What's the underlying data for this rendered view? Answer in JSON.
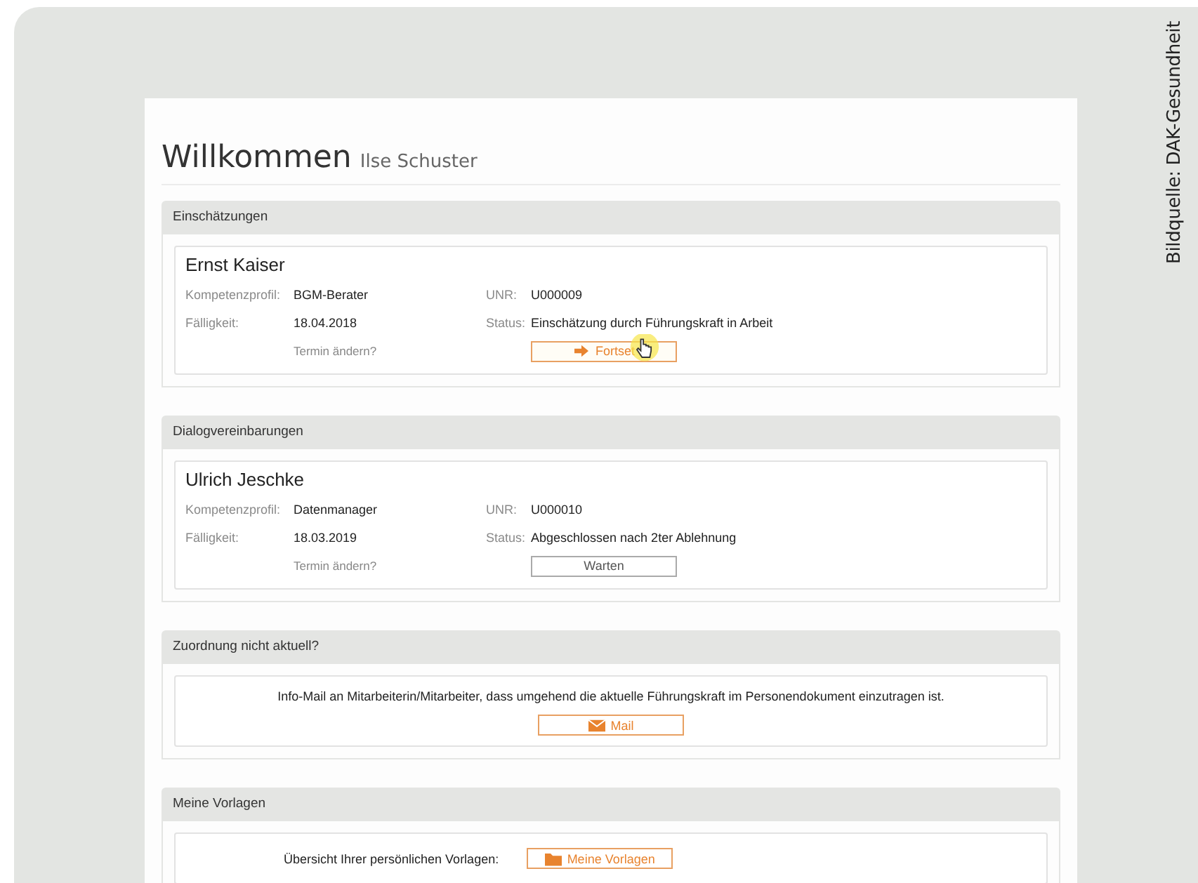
{
  "credit": "Bildquelle: DAK-Gesundheit",
  "page": {
    "title": "Willkommen",
    "user": "Ilse Schuster"
  },
  "sections": [
    {
      "title": "Einschätzungen",
      "kind": "record",
      "record": {
        "name": "Ernst Kaiser",
        "rows": [
          {
            "label": "Kompetenzprofil:",
            "value": "BGM-Berater",
            "label_2": "UNR:",
            "value_2": "U000009"
          },
          {
            "label": "Fälligkeit:",
            "value": "18.04.2018",
            "label_2": "Status:",
            "value_2": "Einschätzung durch Führungskraft in Arbeit"
          }
        ],
        "link": "Termin ändern?",
        "button": {
          "label": "Fortset",
          "kind": "continue",
          "hovered": true
        }
      }
    },
    {
      "title": "Dialogvereinbarungen",
      "kind": "record",
      "record": {
        "name": "Ulrich Jeschke",
        "rows": [
          {
            "label": "Kompetenzprofil:",
            "value": "Datenmanager",
            "label_2": "UNR:",
            "value_2": "U000010"
          },
          {
            "label": "Fälligkeit:",
            "value": "18.03.2019",
            "label_2": "Status:",
            "value_2": "Abgeschlossen nach 2ter Ablehnung"
          }
        ],
        "link": "Termin ändern?",
        "button": {
          "label": "Warten",
          "kind": "wait",
          "hovered": false
        }
      }
    },
    {
      "title": "Zuordnung nicht aktuell?",
      "kind": "notice",
      "text": "Info-Mail an Mitarbeiterin/Mitarbeiter, dass umgehend die aktuelle Führungskraft im Personendokument einzutragen ist.",
      "button": {
        "label": "Mail",
        "kind": "mail",
        "hovered": false
      }
    },
    {
      "title": "Meine Vorlagen",
      "kind": "inline",
      "text": "Übersicht Ihrer persönlichen Vorlagen:",
      "button": {
        "label": "Meine Vorlagen",
        "kind": "templates",
        "hovered": false
      }
    }
  ]
}
